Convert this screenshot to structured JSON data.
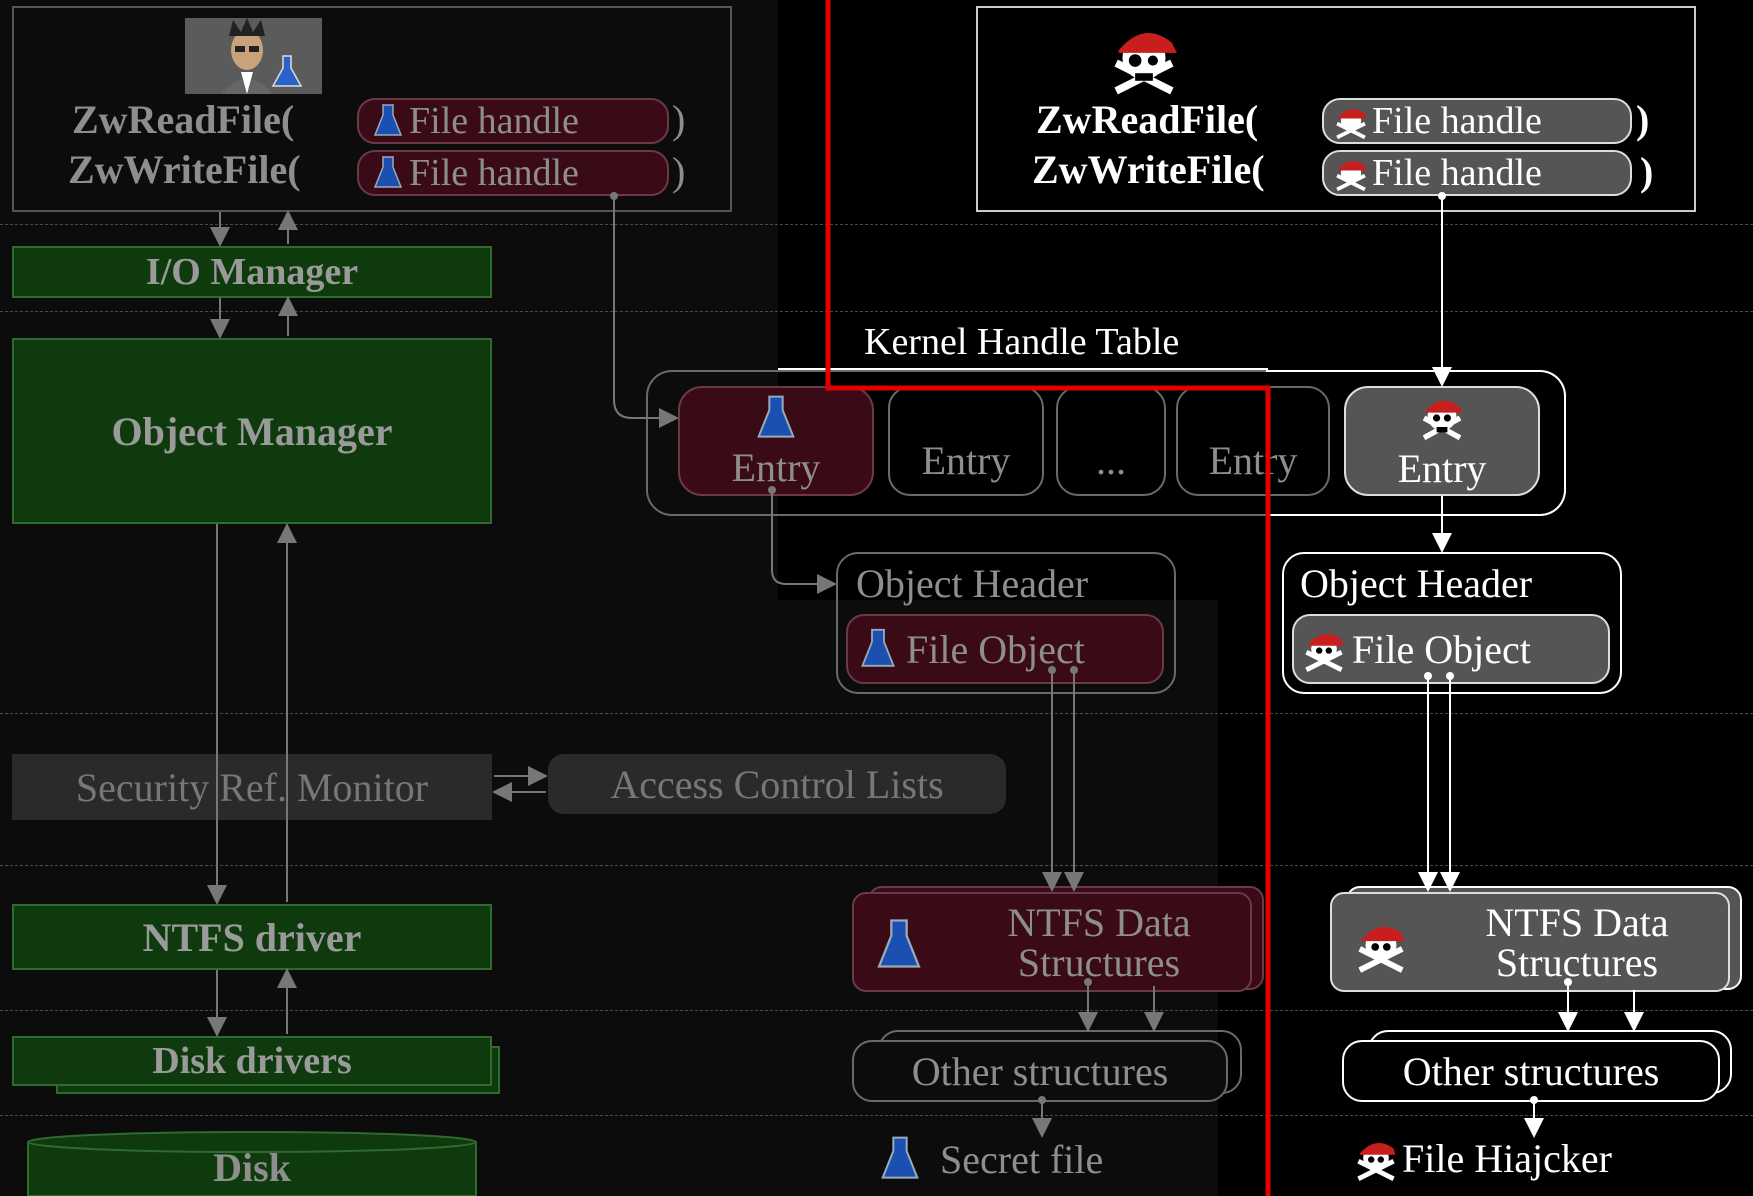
{
  "left": {
    "zw_read": "ZwReadFile(",
    "zw_write": "ZwWriteFile(",
    "file_handle": "File handle",
    "close_paren": ")",
    "io_manager": "I/O Manager",
    "object_manager": "Object Manager",
    "security_monitor": "Security Ref. Monitor",
    "acl": "Access Control Lists",
    "ntfs_driver": "NTFS driver",
    "disk_drivers": "Disk drivers",
    "disk": "Disk"
  },
  "handle_table": {
    "title": "Kernel Handle Table",
    "entries": [
      "Entry",
      "Entry",
      "...",
      "Entry",
      "Entry"
    ]
  },
  "middle": {
    "object_header": "Object Header",
    "file_object": "File Object",
    "ntfs_data_line1": "NTFS Data",
    "ntfs_data_line2": "Structures",
    "other_structures": "Other structures",
    "secret_file": "Secret file"
  },
  "right": {
    "zw_read": "ZwReadFile(",
    "zw_write": "ZwWriteFile(",
    "file_handle": "File handle",
    "close_paren": ")",
    "object_header": "Object Header",
    "file_object": "File Object",
    "ntfs_data_line1": "NTFS Data",
    "ntfs_data_line2": "Structures",
    "other_structures": "Other structures",
    "hijacker": "File Hiajcker"
  },
  "icons": {
    "flask": "flask-icon",
    "pirate": "pirate-skull-icon",
    "scientist": "scientist-avatar"
  },
  "colors": {
    "background": "#000000",
    "green_box": "#0e3a0e",
    "maroon_box": "#3a0a16",
    "grey_box": "#555555",
    "red_boundary": "#e00000",
    "flask_blue": "#1b4fb0",
    "pirate_red": "#c81e1e"
  }
}
